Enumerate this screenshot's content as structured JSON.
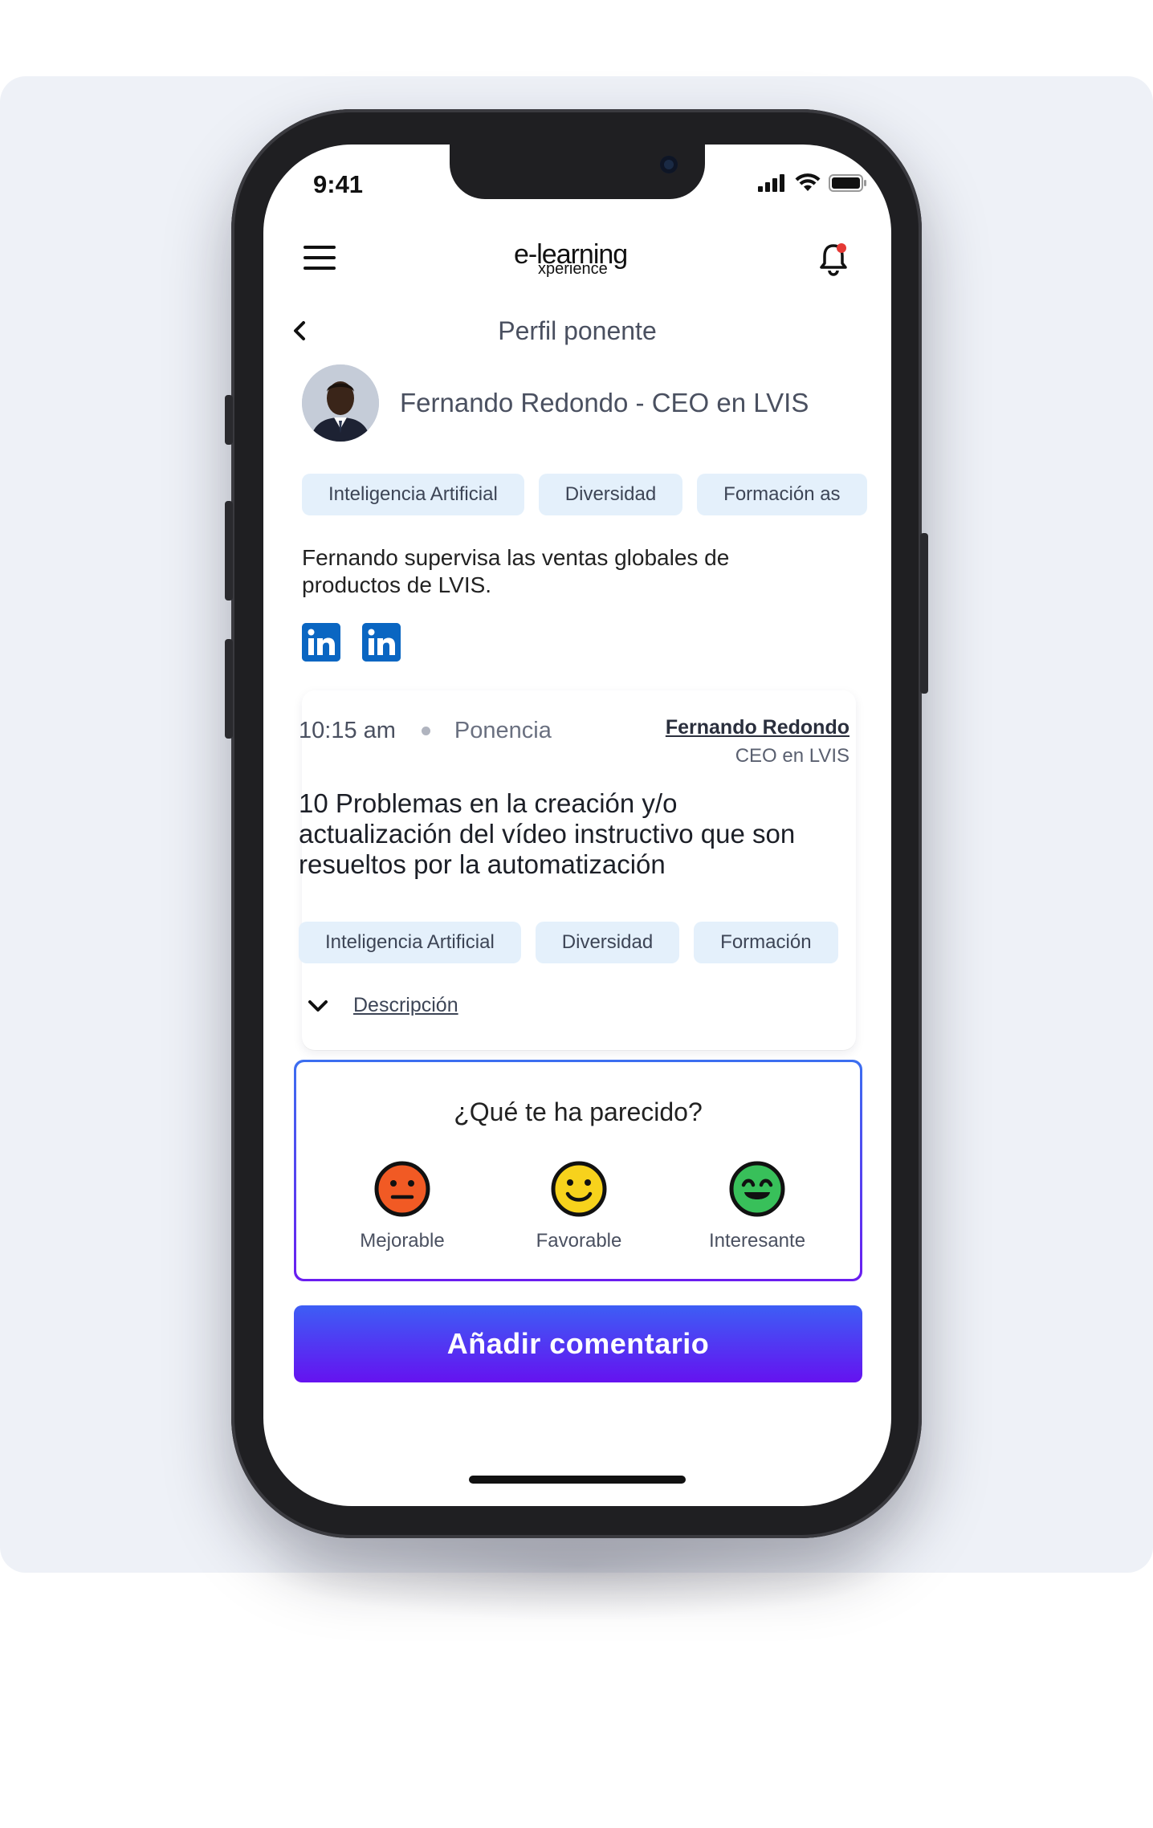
{
  "status_bar": {
    "time": "9:41"
  },
  "header": {
    "logo_main": "e-learning",
    "logo_sub": "xperience"
  },
  "page": {
    "title": "Perfil ponente"
  },
  "speaker": {
    "name": "Fernando Redondo - CEO en LVIS",
    "tags": [
      "Inteligencia Artificial",
      "Diversidad",
      "Formación as"
    ],
    "bio": "Fernando supervisa las ventas globales de productos de LVIS.",
    "social": [
      "linkedin-icon",
      "linkedin-icon"
    ]
  },
  "session": {
    "time": "10:15 am",
    "type": "Ponencia",
    "speaker_name": "Fernando Redondo",
    "speaker_role": "CEO en LVIS",
    "title": "10 Problemas en la creación y/o actualización del vídeo instructivo que son resueltos por la automatización",
    "tags": [
      "Inteligencia Artificial",
      "Diversidad",
      "Formación"
    ],
    "description_label": "Descripción"
  },
  "feedback": {
    "question": "¿Qué te ha parecido?",
    "options": [
      {
        "label": "Mejorable",
        "icon": "neutral-face-icon",
        "color": "#f15a24"
      },
      {
        "label": "Favorable",
        "icon": "smile-face-icon",
        "color": "#f7d21c"
      },
      {
        "label": "Interesante",
        "icon": "happy-face-icon",
        "color": "#38c05a"
      }
    ]
  },
  "cta": {
    "label": "Añadir comentario"
  },
  "colors": {
    "accent_start": "#3d5ef5",
    "accent_end": "#6512f0",
    "chip_bg": "#e4f0fb",
    "linkedin": "#0a66c2",
    "notification_dot": "#e53935"
  }
}
